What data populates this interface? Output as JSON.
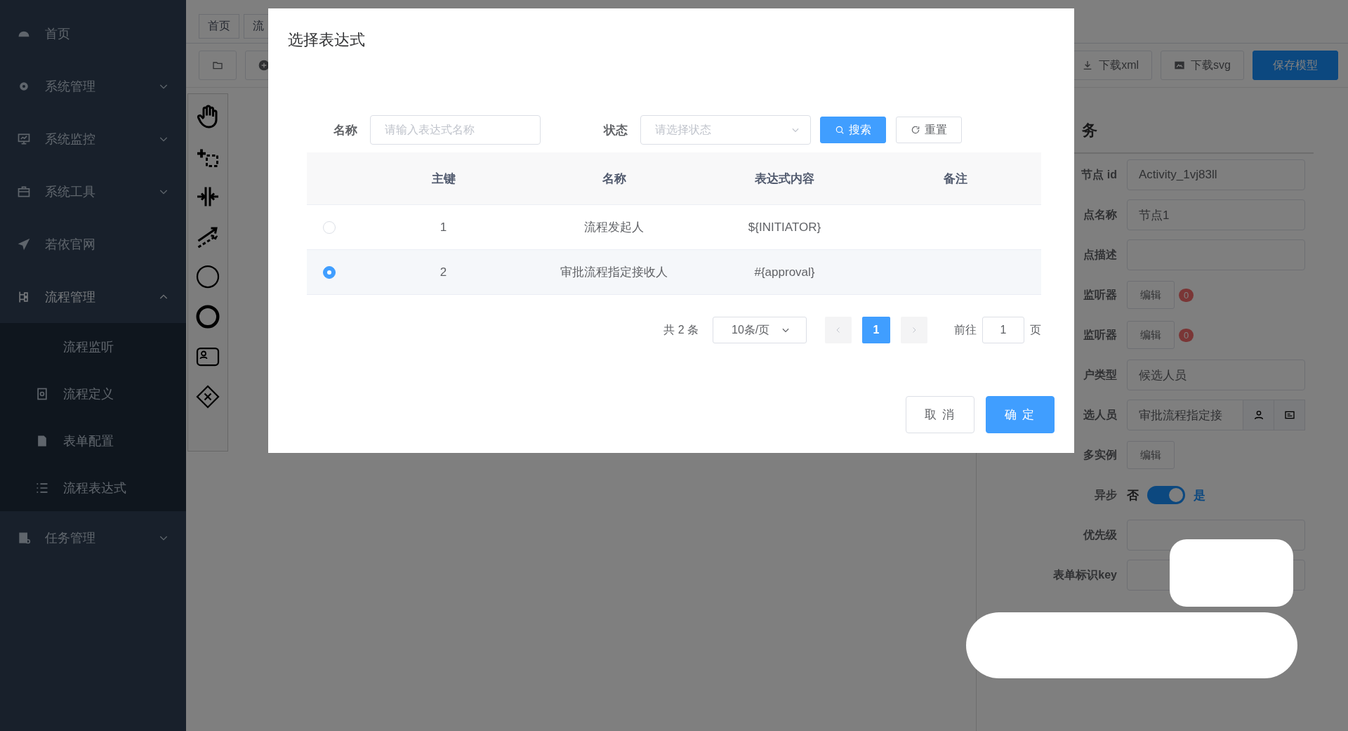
{
  "sidebar": {
    "items": [
      {
        "label": "首页",
        "kind": "link"
      },
      {
        "label": "系统管理",
        "kind": "group",
        "expanded": false
      },
      {
        "label": "系统监控",
        "kind": "group",
        "expanded": false
      },
      {
        "label": "系统工具",
        "kind": "group",
        "expanded": false
      },
      {
        "label": "若依官网",
        "kind": "link"
      },
      {
        "label": "流程管理",
        "kind": "group",
        "expanded": true,
        "children": [
          {
            "label": "流程监听"
          },
          {
            "label": "流程定义"
          },
          {
            "label": "表单配置"
          },
          {
            "label": "流程表达式"
          }
        ]
      },
      {
        "label": "任务管理",
        "kind": "group",
        "expanded": false
      }
    ]
  },
  "tags": [
    "首页",
    "流"
  ],
  "toolbar": {
    "actions": [
      "下载xml",
      "下载svg",
      "保存模型"
    ]
  },
  "panel": {
    "heading": "务",
    "rows": [
      {
        "kind": "input",
        "label": "节点 id",
        "value": "Activity_1vj83ll"
      },
      {
        "kind": "input",
        "label": "点名称",
        "value": "节点1"
      },
      {
        "kind": "input",
        "label": "点描述"
      },
      {
        "kind": "edit",
        "label": "监听器",
        "button": "编辑",
        "badge": "0"
      },
      {
        "kind": "edit",
        "label": "监听器",
        "button": "编辑",
        "badge": "0"
      },
      {
        "kind": "select",
        "label": "户类型",
        "value": "候选人员"
      },
      {
        "kind": "picker",
        "label": "选人员",
        "value": "审批流程指定接"
      },
      {
        "kind": "edit",
        "label": "多实例",
        "button": "编辑"
      },
      {
        "kind": "switch",
        "label": "异步",
        "off_text": "否",
        "on_text": "是",
        "on": true
      },
      {
        "kind": "input",
        "label": "优先级"
      },
      {
        "kind": "input",
        "label": "表单标识key"
      }
    ]
  },
  "dialog": {
    "title": "选择表达式",
    "filters": [
      {
        "kind": "input",
        "label": "名称",
        "placeholder": "请输入表达式名称"
      },
      {
        "kind": "select",
        "label": "状态",
        "placeholder": "请选择状态"
      }
    ],
    "search_button": "搜索",
    "reset_button": "重置",
    "table": {
      "columns": [
        "主键",
        "名称",
        "表达式内容",
        "备注"
      ],
      "rows": [
        {
          "selected": false,
          "cells": [
            "1",
            "流程发起人",
            "${INITIATOR}",
            ""
          ]
        },
        {
          "selected": true,
          "cells": [
            "2",
            "审批流程指定接收人",
            "#{approval}",
            ""
          ]
        }
      ]
    },
    "pagination": {
      "total": "共 2 条",
      "page_size": "10条/页",
      "pages": [
        {
          "label": "1",
          "selected": true
        }
      ],
      "goto_label": "前往",
      "goto_value": "1",
      "goto_suffix": "页"
    },
    "buttons": [
      {
        "label": "取 消",
        "kind": "default"
      },
      {
        "label": "确 定",
        "kind": "primary"
      }
    ]
  }
}
